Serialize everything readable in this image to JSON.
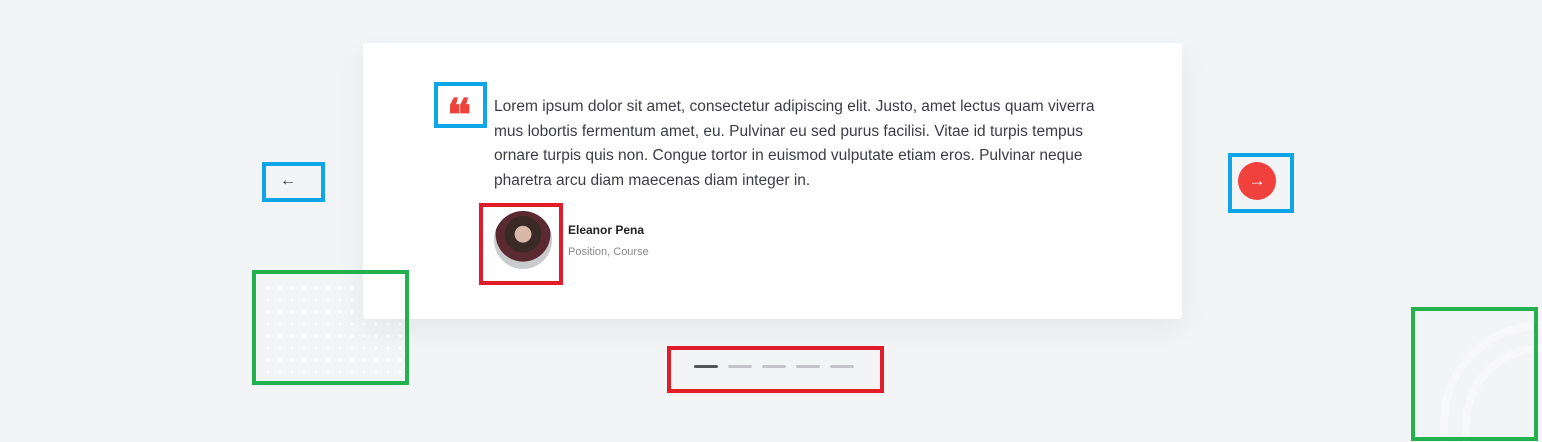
{
  "testimonial": {
    "quote": "Lorem ipsum dolor sit amet, consectetur adipiscing elit. Justo, amet lectus quam viverra mus lobortis fermentum amet, eu. Pulvinar eu sed purus facilisi. Vitae id turpis tempus ornare turpis quis non. Congue tortor in euismod vulputate etiam eros. Pulvinar neque pharetra arcu diam maecenas diam integer in.",
    "quote_mark": "❛❛",
    "author_name": "Eleanor Pena",
    "author_role": "Position, Course"
  },
  "nav": {
    "prev": "←",
    "next": "→"
  },
  "pagination": {
    "count": 5,
    "active_index": 0
  },
  "colors": {
    "accent": "#f0413d",
    "background": "#f3f4f6"
  }
}
